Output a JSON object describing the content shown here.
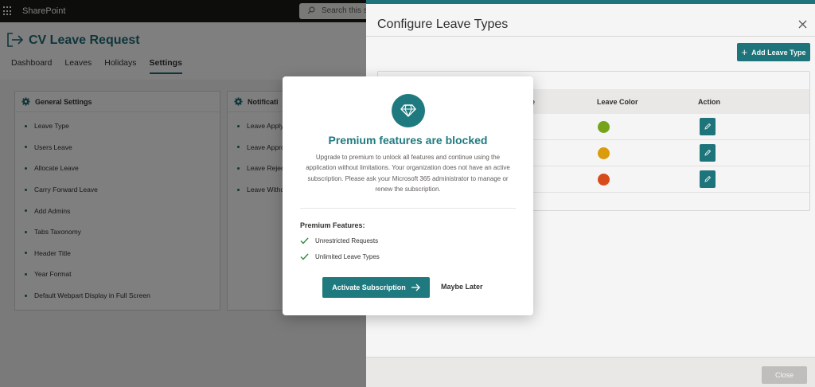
{
  "suitebar": {
    "brand": "SharePoint",
    "search_placeholder": "Search this si"
  },
  "app": {
    "title": "CV Leave Request",
    "tabs": [
      {
        "label": "Dashboard",
        "active": false
      },
      {
        "label": "Leaves",
        "active": false
      },
      {
        "label": "Holidays",
        "active": false
      },
      {
        "label": "Settings",
        "active": true
      }
    ]
  },
  "general_settings": {
    "title": "General Settings",
    "items": [
      "Leave Type",
      "Users Leave",
      "Allocate Leave",
      "Carry Forward Leave",
      "Add Admins",
      "Tabs Taxonomy",
      "Header Title",
      "Year Format",
      "Default Webpart Display in Full Screen"
    ]
  },
  "notification_settings": {
    "title": "Notificati",
    "items": [
      "Leave Apply",
      "Leave Appro",
      "Leave Reject",
      "Leave Withdr"
    ]
  },
  "panel": {
    "title": "Configure Leave Types",
    "add_button": "Add Leave Type",
    "columns": {
      "name_fragment": "e",
      "color": "Leave Color",
      "action": "Action"
    },
    "rows": [
      {
        "color": "#7aab1d"
      },
      {
        "color": "#e3a20e"
      },
      {
        "color": "#e0501c"
      }
    ],
    "close_button": "Close"
  },
  "modal": {
    "title": "Premium features are blocked",
    "description": "Upgrade to premium to unlock all features and continue using the application without limitations. Your organization does not have an active subscription. Please ask your Microsoft 365 administrator to manage or renew the subscription.",
    "features_title": "Premium Features:",
    "features": [
      "Unrestricted Requests",
      "Unlimited Leave Types"
    ],
    "activate_button": "Activate Subscription",
    "later_button": "Maybe Later"
  },
  "colors": {
    "accent": "#1f7a80",
    "title_teal": "#1f6b75"
  },
  "icons": {
    "badge": "diamond-icon",
    "check": "check-icon",
    "arrow": "arrow-right-icon",
    "edit": "pencil-icon"
  }
}
